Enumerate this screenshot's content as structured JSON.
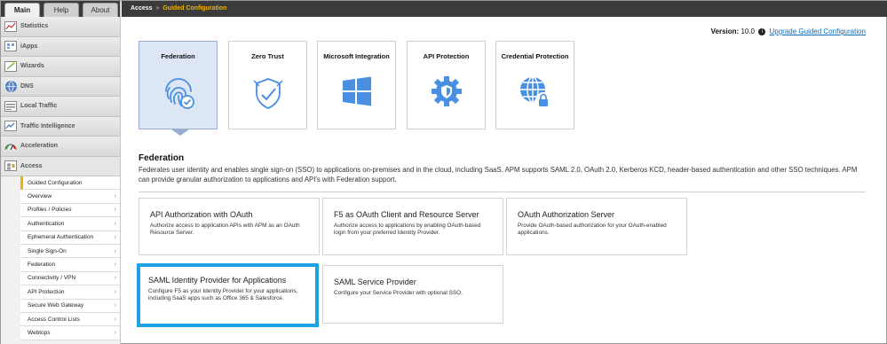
{
  "tabs": [
    "Main",
    "Help",
    "About"
  ],
  "nav": [
    {
      "label": "Statistics",
      "icon": "chart-icon"
    },
    {
      "label": "iApps",
      "icon": "iapps-icon"
    },
    {
      "label": "Wizards",
      "icon": "wizard-icon"
    },
    {
      "label": "DNS",
      "icon": "globe-icon"
    },
    {
      "label": "Local Traffic",
      "icon": "local-traffic-icon"
    },
    {
      "label": "Traffic Intelligence",
      "icon": "traffic-intelligence-icon"
    },
    {
      "label": "Acceleration",
      "icon": "gauge-icon"
    },
    {
      "label": "Access",
      "icon": "access-icon"
    }
  ],
  "submenu": [
    "Guided Configuration",
    "Overview",
    "Profiles / Policies",
    "Authentication",
    "Ephemeral Authentication",
    "Single Sign-On",
    "Federation",
    "Connectivity / VPN",
    "API Protection",
    "Secure Web Gateway",
    "Access Control Lists",
    "Webtops"
  ],
  "breadcrumb": {
    "root": "Access",
    "sep": "»",
    "current": "Guided Configuration"
  },
  "version": {
    "label": "Version:",
    "value": "10.0",
    "link": "Upgrade Guided Configuration"
  },
  "categories": [
    {
      "title": "Federation",
      "icon": "fingerprint-icon"
    },
    {
      "title": "Zero Trust",
      "icon": "shield-check-icon"
    },
    {
      "title": "Microsoft Integration",
      "icon": "windows-icon"
    },
    {
      "title": "API Protection",
      "icon": "gear-shield-icon"
    },
    {
      "title": "Credential Protection",
      "icon": "globe-lock-icon"
    }
  ],
  "section": {
    "title": "Federation",
    "description": "Federates user identity and enables single sign-on (SSO) to applications on-premises and in the cloud, including SaaS. APM supports SAML 2.0, OAuth 2.0, Kerberos KCD, header-based authentication and other SSO techniques. APM can provide granular authorization to applications and API's with Federation support."
  },
  "options": [
    {
      "title": "API Authorization with OAuth",
      "desc": "Authorize access to application APIs with APM as an OAuth Resource Server."
    },
    {
      "title": "F5 as OAuth Client and Resource Server",
      "desc": "Authorize access to applications by enabling OAuth-based login from your preferred Identity Provider."
    },
    {
      "title": "OAuth Authorization Server",
      "desc": "Provide OAuth-based authorization for your OAuth-enabled applications."
    },
    {
      "title": "SAML Identity Provider for Applications",
      "desc": "Configure F5 as your Identity Provider for your applications, including SaaS apps such as Office 365 & Salesforce."
    },
    {
      "title": "SAML Service Provider",
      "desc": "Configure your Service Provider with optional SSO."
    }
  ],
  "colors": {
    "accent": "#4a90e2",
    "highlight": "#1ea2e3",
    "selected": "#dce6f5",
    "topbar": "#3b3b3b",
    "active": "#f0b400"
  }
}
